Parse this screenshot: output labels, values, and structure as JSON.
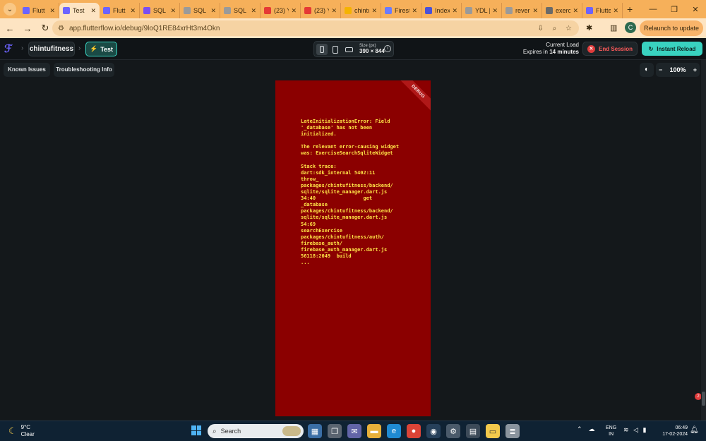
{
  "browser": {
    "tabs": [
      {
        "label": "Flutt",
        "color": "#6c63ff",
        "active": false
      },
      {
        "label": "Test",
        "color": "#6c63ff",
        "active": true
      },
      {
        "label": "Flutt",
        "color": "#6c63ff",
        "active": false
      },
      {
        "label": "SQL",
        "color": "#7b4ef0",
        "active": false
      },
      {
        "label": "SQL",
        "color": "#9a9a9a",
        "active": false
      },
      {
        "label": "SQL",
        "color": "#9a9a9a",
        "active": false
      },
      {
        "label": "(23) You",
        "color": "#e53935",
        "active": false
      },
      {
        "label": "(23) You",
        "color": "#e53935",
        "active": false
      },
      {
        "label": "chintufi",
        "color": "#f5b300",
        "active": false
      },
      {
        "label": "Firesto",
        "color": "#6b7cff",
        "active": false
      },
      {
        "label": "Index |",
        "color": "#4a52d8",
        "active": false
      },
      {
        "label": "YDL | A",
        "color": "#9a9a9a",
        "active": false
      },
      {
        "label": "reverse",
        "color": "#9a9a9a",
        "active": false
      },
      {
        "label": "exercis",
        "color": "#6a6a6a",
        "active": false
      },
      {
        "label": "Flutterl",
        "color": "#6c63ff",
        "active": false
      }
    ],
    "new_tab": "+",
    "url": "app.flutterflow.io/debug/9loQ1RE84xrHt3m4Okn",
    "profile_initial": "C",
    "relaunch_label": "Relaunch to update"
  },
  "header": {
    "project_name": "chintufitness",
    "test_label": "Test",
    "size_label": "Size (px)",
    "size_value": "390 × 844",
    "current_load_label": "Current Load",
    "expires_prefix": "Expires in",
    "expires_value": "14 minutes",
    "end_session_label": "End Session",
    "instant_reload_label": "Instant Reload"
  },
  "workspace": {
    "known_issues_label": "Known Issues",
    "troubleshooting_label": "Troubleshooting Info",
    "zoom_minus": "−",
    "zoom_value": "100%",
    "zoom_plus": "+",
    "notification_count": "2"
  },
  "phone": {
    "debug_ribbon": "DEBUG",
    "error_text": "LateInitializationError: Field\n'_database' has not been\ninitialized.\n\nThe relevant error-causing widget\nwas: ExerciseSearchSqliteWidget\n\nStack trace:\ndart:sdk_internal 5402:11\nthrow_\npackages/chintufitness/backend/\nsqlite/sqlite_manager.dart.js\n34:40                get\n_database\npackages/chintufitness/backend/\nsqlite/sqlite_manager.dart.js\n54:69\nsearchExercise\npackages/chintufitness/auth/\nfirebase_auth/\nfirebase_auth_manager.dart.js\n56118:2049  build\n..."
  },
  "taskbar": {
    "temperature": "9°C",
    "condition": "Clear",
    "search_placeholder": "Search",
    "lang_line1": "ENG",
    "lang_line2": "IN",
    "time": "06:49",
    "date": "17-02-2024"
  }
}
